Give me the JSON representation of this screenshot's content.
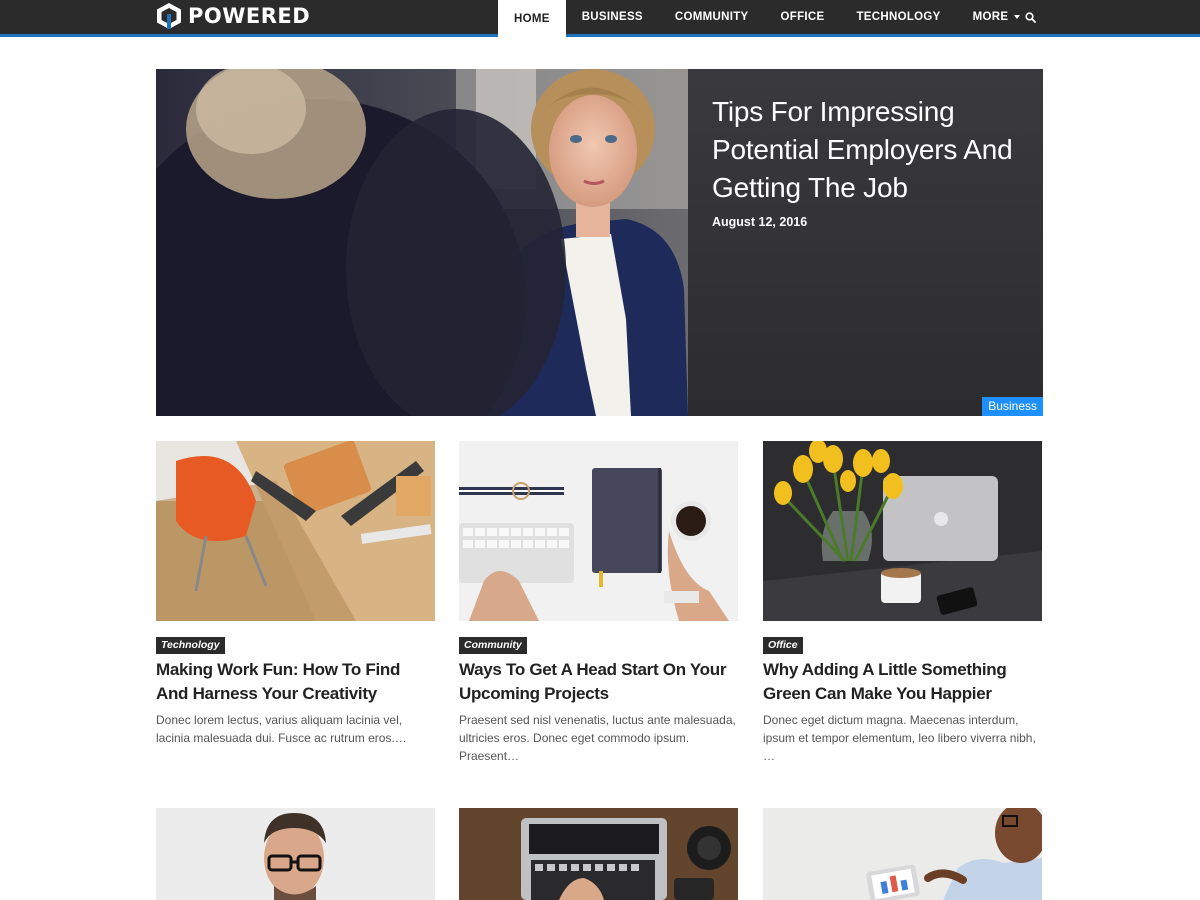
{
  "site": {
    "logo_text": "POWERED",
    "accent_color": "#1e73be",
    "badge_color": "#1e8fff"
  },
  "nav": {
    "items": [
      {
        "label": "HOME",
        "active": true
      },
      {
        "label": "BUSINESS",
        "active": false
      },
      {
        "label": "COMMUNITY",
        "active": false
      },
      {
        "label": "OFFICE",
        "active": false
      },
      {
        "label": "TECHNOLOGY",
        "active": false
      },
      {
        "label": "MORE",
        "active": false,
        "has_dropdown": true
      }
    ],
    "search_icon": "search-icon"
  },
  "hero": {
    "title": "Tips For Impressing Potential Employers And Getting The Job",
    "date": "August 12, 2016",
    "category": "Business",
    "image": "photo-woman-interview"
  },
  "posts": [
    {
      "category": "Technology",
      "title": "Making Work Fun: How To Find And Harness Your Creativity",
      "excerpt": "Donec lorem lectus, varius aliquam lacinia vel, lacinia malesuada dui. Fusce ac rutrum eros.…",
      "image": "photo-desk-orange-chair"
    },
    {
      "category": "Community",
      "title": "Ways To Get A Head Start On Your Upcoming Projects",
      "excerpt": "Praesent sed nisl venenatis, luctus ante malesuada, ultricies eros. Donec eget commodo ipsum. Praesent…",
      "image": "photo-keyboard-notebook-coffee"
    },
    {
      "category": "Office",
      "title": "Why Adding A Little Something Green Can Make You Happier",
      "excerpt": "Donec eget dictum magna. Maecenas interdum, ipsum et tempor elementum, leo libero viverra nibh, …",
      "image": "photo-tulips-laptop"
    }
  ],
  "more_posts": [
    {
      "image": "photo-man-glasses"
    },
    {
      "image": "photo-laptop-typing"
    },
    {
      "image": "photo-tablet-charts"
    }
  ]
}
